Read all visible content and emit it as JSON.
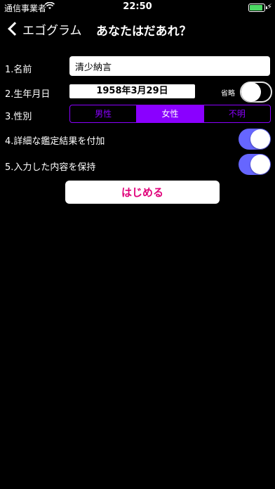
{
  "status_bar": {
    "carrier": "通信事業者",
    "time": "22:50",
    "battery_level": 1.0,
    "charging": true
  },
  "nav": {
    "back_label": "エゴグラム",
    "title": "あなたはだあれ？"
  },
  "form": {
    "name": {
      "label": "1.名前",
      "value": "清少納言"
    },
    "birthday": {
      "label": "2.生年月日",
      "value": "1958年3月29日",
      "omit_label": "省略",
      "omit_on": false
    },
    "gender": {
      "label": "3.性別",
      "options": [
        "男性",
        "女性",
        "不明"
      ],
      "selected": "女性"
    },
    "detail": {
      "label": "4.詳細な鑑定結果を付加",
      "on": true
    },
    "keep": {
      "label": "5.入力した内容を保持",
      "on": true
    }
  },
  "start_button": {
    "label": "はじめる"
  },
  "colors": {
    "accent_purple": "#8a00ff",
    "switch_on": "#6666ff",
    "button_text": "#e0007a",
    "background": "#000000"
  }
}
